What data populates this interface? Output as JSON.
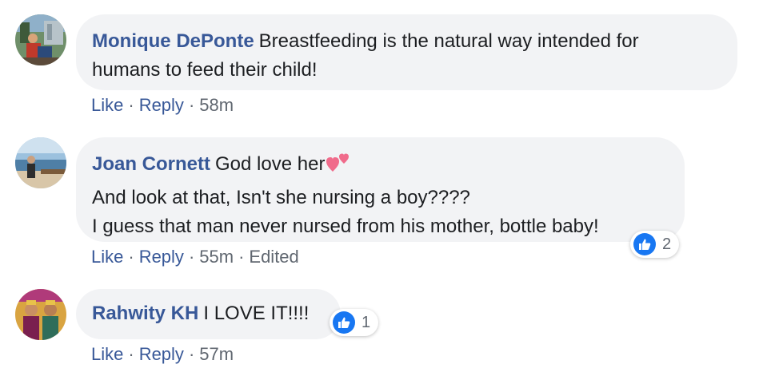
{
  "comments": [
    {
      "author": "Monique DePonte",
      "lines": [
        "Breastfeeding is the natural way intended for",
        "humans to feed their child!"
      ],
      "actions": {
        "like": "Like",
        "reply": "Reply",
        "time": "58m"
      }
    },
    {
      "author": "Joan Cornett",
      "lines": [
        "God love her",
        "And look at that, Isn't she nursing a boy????",
        "I guess that man never nursed from his mother, bottle baby!"
      ],
      "emoji": "two-hearts-icon",
      "reaction_count": "2",
      "actions": {
        "like": "Like",
        "reply": "Reply",
        "time": "55m",
        "edited": "Edited"
      }
    },
    {
      "author": "Rahwity KH",
      "lines": [
        "I LOVE IT!!!!"
      ],
      "reaction_count": "1",
      "actions": {
        "like": "Like",
        "reply": "Reply",
        "time": "57m"
      }
    }
  ],
  "colors": {
    "author": "#385898",
    "bubble": "#f2f3f5",
    "meta": "#606770",
    "like_badge": "#1877f2"
  }
}
